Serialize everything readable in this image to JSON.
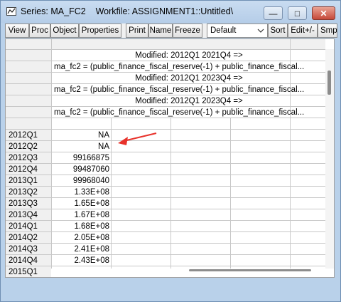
{
  "window": {
    "title": "Series: MA_FC2    Workfile: ASSIGNMENT1::Untitled\\",
    "min_glyph": "—",
    "max_glyph": "□",
    "close_glyph": "✕"
  },
  "toolbar": {
    "buttons": [
      "View",
      "Proc",
      "Object",
      "Properties",
      "Print",
      "Name",
      "Freeze",
      "Sort",
      "Edit+/-",
      "Smp"
    ],
    "sample_select": "Default"
  },
  "comments": [
    "Modified: 2012Q1 2021Q4 =>",
    "ma_fc2 = (public_finance_fiscal_reserve(-1) + public_finance_fiscal...",
    "Modified: 2012Q1 2023Q4 =>",
    "ma_fc2 = (public_finance_fiscal_reserve(-1) + public_finance_fiscal...",
    "Modified: 2012Q1 2023Q4 =>",
    "ma_fc2 = (public_finance_fiscal_reserve(-1) + public_finance_fiscal..."
  ],
  "rows": [
    {
      "label": "2012Q1",
      "value": "NA"
    },
    {
      "label": "2012Q2",
      "value": "NA"
    },
    {
      "label": "2012Q3",
      "value": "99166875"
    },
    {
      "label": "2012Q4",
      "value": "99487060"
    },
    {
      "label": "2013Q1",
      "value": "99968040"
    },
    {
      "label": "2013Q2",
      "value": "1.33E+08"
    },
    {
      "label": "2013Q3",
      "value": "1.65E+08"
    },
    {
      "label": "2013Q4",
      "value": "1.67E+08"
    },
    {
      "label": "2014Q1",
      "value": "1.68E+08"
    },
    {
      "label": "2014Q2",
      "value": "2.05E+08"
    },
    {
      "label": "2014Q3",
      "value": "2.41E+08"
    },
    {
      "label": "2014Q4",
      "value": "2.43E+08"
    },
    {
      "label": "2015Q1",
      "value": ""
    }
  ],
  "annotation": {
    "color": "#e8322b",
    "icon": "red-arrow"
  }
}
